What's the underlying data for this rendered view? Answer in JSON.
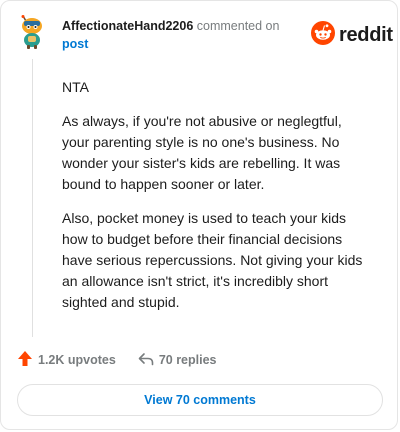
{
  "comment": {
    "username": "AffectionateHand2206",
    "action_text": "commented on",
    "post_link": "post",
    "paragraphs": [
      "NTA",
      "As always, if you're not abusive or neglegtful, your parenting style is no one's business. No wonder your sister's kids are rebelling. It was bound to happen sooner or later.",
      "Also, pocket money is used to teach your kids how to budget before their financial decisions have serious repercussions. Not giving your kids an allowance isn't strict, it's incredibly short sighted and stupid."
    ]
  },
  "brand": {
    "wordmark": "reddit",
    "color": "#ff4500"
  },
  "actions": {
    "upvotes": "1.2K upvotes",
    "replies": "70 replies"
  },
  "view_button": {
    "label": "View 70 comments"
  },
  "colors": {
    "link": "#0079d3",
    "upvote": "#ff4500",
    "muted": "#787c7e"
  }
}
